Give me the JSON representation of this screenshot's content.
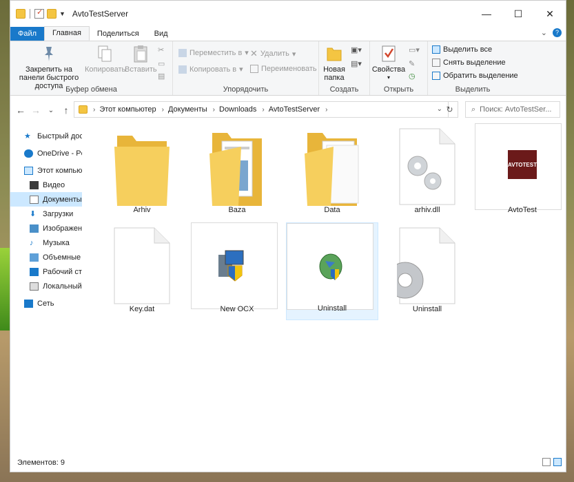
{
  "window": {
    "title": "AvtoTestServer",
    "controls": {
      "minimize": "—",
      "maximize": "☐",
      "close": "✕"
    }
  },
  "ribbon_tabs": [
    "Файл",
    "Главная",
    "Поделиться",
    "Вид"
  ],
  "ribbon": {
    "clipboard": {
      "pin": "Закрепить на панели быстрого доступа",
      "copy": "Копировать",
      "paste": "Вставить",
      "label": "Буфер обмена"
    },
    "organize": {
      "move": "Переместить в",
      "copy_to": "Копировать в",
      "delete": "Удалить",
      "rename": "Переименовать",
      "label": "Упорядочить"
    },
    "new": {
      "new_folder": "Новая папка",
      "label": "Создать"
    },
    "open": {
      "properties": "Свойства",
      "label": "Открыть"
    },
    "select": {
      "select_all": "Выделить все",
      "select_none": "Снять выделение",
      "invert": "Обратить выделение",
      "label": "Выделить"
    }
  },
  "address": {
    "crumbs": [
      "Этот компьютер",
      "Документы",
      "Downloads",
      "AvtoTestServer"
    ],
    "search_placeholder": "Поиск: AvtoTestSer..."
  },
  "nav_items": [
    {
      "label": "Быстрый досту",
      "icon": "star-icon"
    },
    {
      "label": "OneDrive - Per",
      "icon": "cloud-icon"
    },
    {
      "label": "Этот компьют",
      "icon": "computer-icon"
    },
    {
      "label": "Видео",
      "icon": "video-icon"
    },
    {
      "label": "Документы",
      "icon": "document-icon"
    },
    {
      "label": "Загрузки",
      "icon": "download-icon"
    },
    {
      "label": "Изображени",
      "icon": "image-icon"
    },
    {
      "label": "Музыка",
      "icon": "music-icon"
    },
    {
      "label": "Объемные о",
      "icon": "cube-icon"
    },
    {
      "label": "Рабочий стол",
      "icon": "desktop-icon"
    },
    {
      "label": "Локальный д",
      "icon": "disk-icon"
    },
    {
      "label": "Сеть",
      "icon": "network-icon"
    }
  ],
  "files": [
    {
      "name": "Arhiv",
      "type": "folder-empty"
    },
    {
      "name": "Baza",
      "type": "folder-docs"
    },
    {
      "name": "Data",
      "type": "folder-papers"
    },
    {
      "name": "arhiv.dll",
      "type": "dll"
    },
    {
      "name": "AvtoTest",
      "type": "logo-image",
      "logo_text": "AVTOTEST"
    },
    {
      "name": "Key.dat",
      "type": "blank"
    },
    {
      "name": "New OCX",
      "type": "installer"
    },
    {
      "name": "Uninstall",
      "type": "uninstall-exe"
    },
    {
      "name": "Uninstall",
      "type": "config"
    }
  ],
  "status": {
    "count_text": "Элементов: 9"
  },
  "colors": {
    "accent": "#1979ca",
    "selection": "#cce8ff",
    "folder": "#f4c542"
  }
}
